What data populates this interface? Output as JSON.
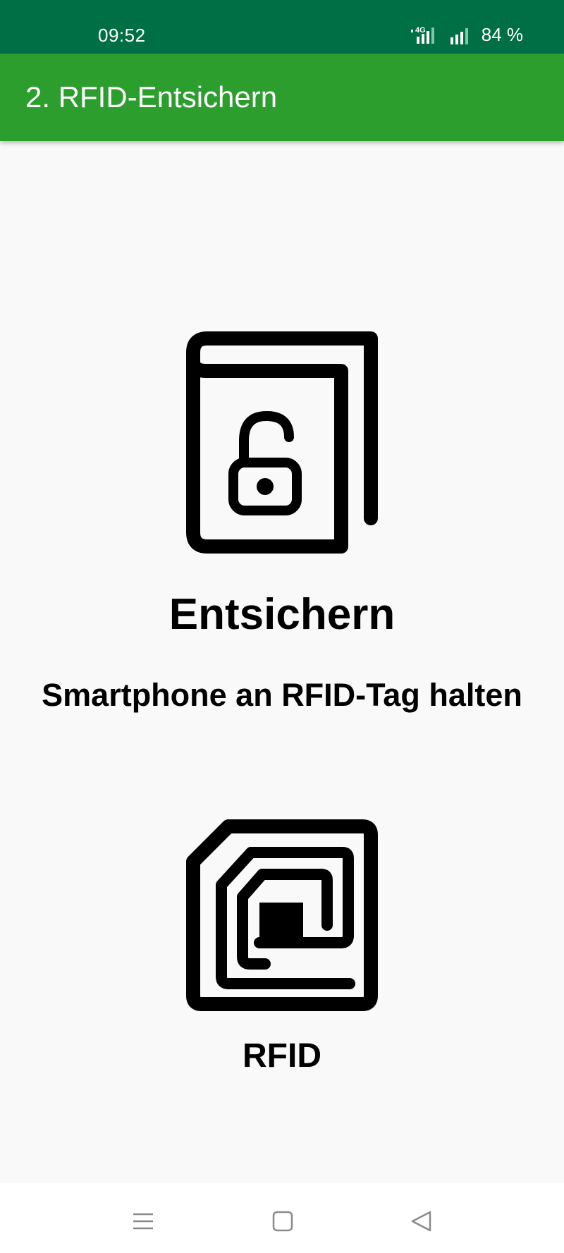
{
  "status_bar": {
    "time": "09:52",
    "network_type": "4G",
    "battery": "84 %",
    "icons": [
      "signal-4g-icon",
      "signal-bars-icon"
    ]
  },
  "app_bar": {
    "title": "2. RFID-Entsichern",
    "color": "#2b9e2e",
    "status_color": "#006f45"
  },
  "main": {
    "icon_top": "unlock-book-icon",
    "heading": "Entsichern",
    "instruction": "Smartphone an RFID-Tag halten",
    "icon_bottom": "rfid-tag-icon",
    "rfid_label": "RFID"
  },
  "nav_bar": {
    "icons": [
      "menu-icon",
      "home-icon",
      "back-icon"
    ]
  }
}
